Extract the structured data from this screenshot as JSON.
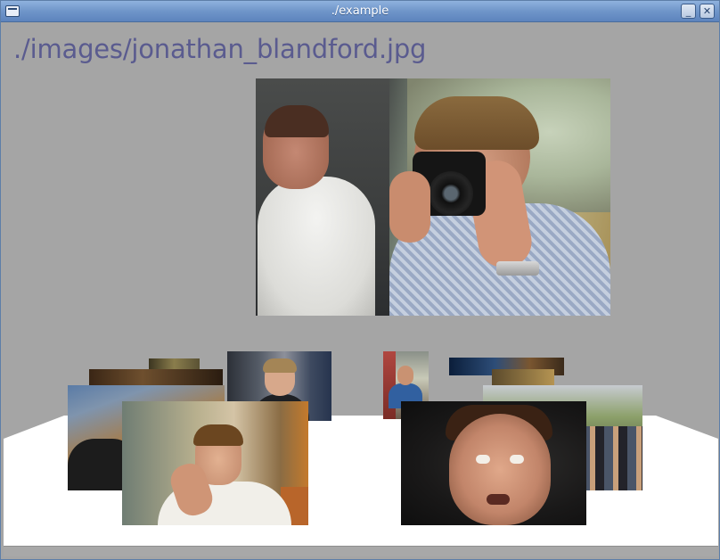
{
  "window": {
    "title": "./example"
  },
  "viewer": {
    "current_path": "./images/jonathan_blandford.jpg"
  },
  "colors": {
    "titlebar_top": "#8fb2de",
    "titlebar_bottom": "#5d84bd",
    "background": "#a5a5a5",
    "floor": "#ffffff",
    "path_text": "#5a5b8f"
  },
  "icons": {
    "window_menu": "window-menu-icon",
    "minimize": "minimize-icon",
    "close": "close-icon"
  },
  "glyphs": {
    "minimize": "_",
    "close": "✕"
  }
}
